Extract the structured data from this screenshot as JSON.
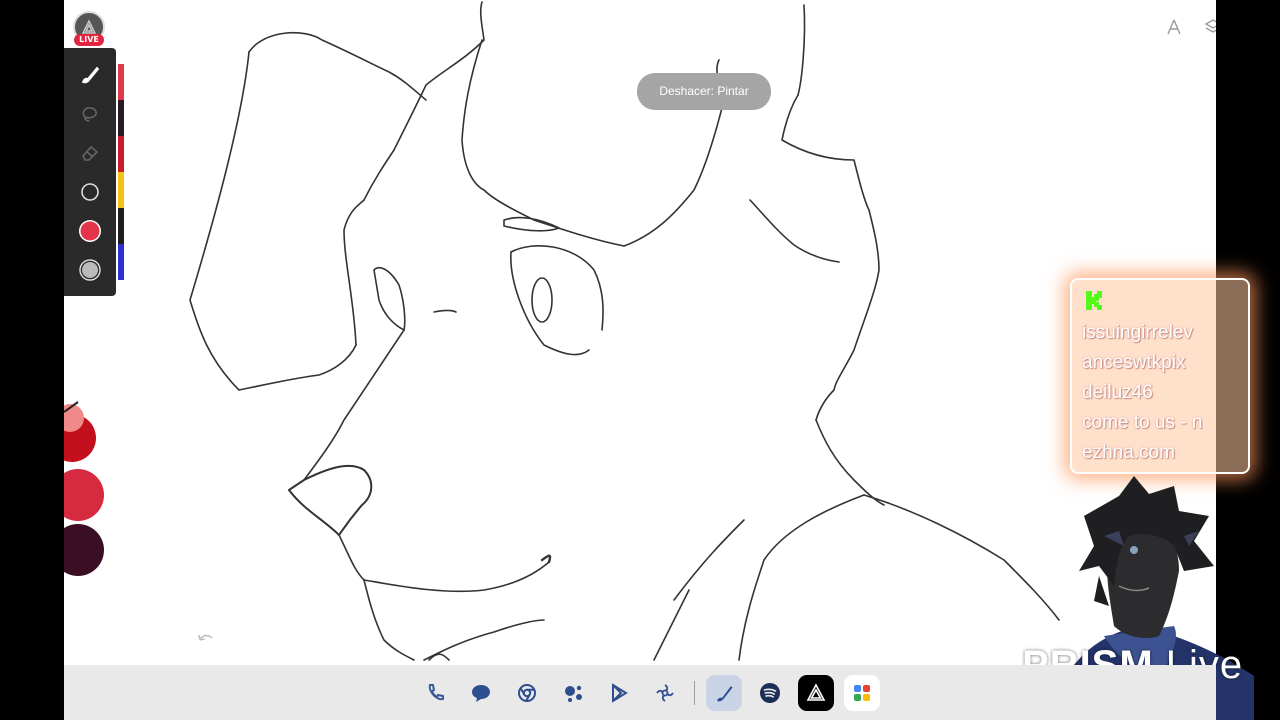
{
  "live_badge": "LIVE",
  "toast": "Deshacer: Pintar",
  "chat": {
    "lines": [
      "issuingirrelev",
      "anceswtkpix",
      "deiluz46",
      "come to us - n",
      "ezhna.com"
    ]
  },
  "toolbar": {
    "tools": [
      "brush-icon",
      "lasso-icon",
      "eraser-icon",
      "brush-size-icon",
      "color-swatch",
      "opacity-icon"
    ],
    "active_color": "#e4344a"
  },
  "color_strip": [
    "#e03a4a",
    "#2a1a25",
    "#c81e2c",
    "#f3c318",
    "#1e1e1e",
    "#2f2fd2"
  ],
  "dock": {
    "apps": [
      "phone-icon",
      "messages-icon",
      "chrome-icon",
      "assistant-icon",
      "play-store-icon",
      "settings-icon",
      "brush-app-icon",
      "spotify-icon",
      "prism-app-icon",
      "app-drawer-icon"
    ]
  },
  "prism": {
    "brand_bold": "PRISM",
    "brand_light": " Live"
  }
}
